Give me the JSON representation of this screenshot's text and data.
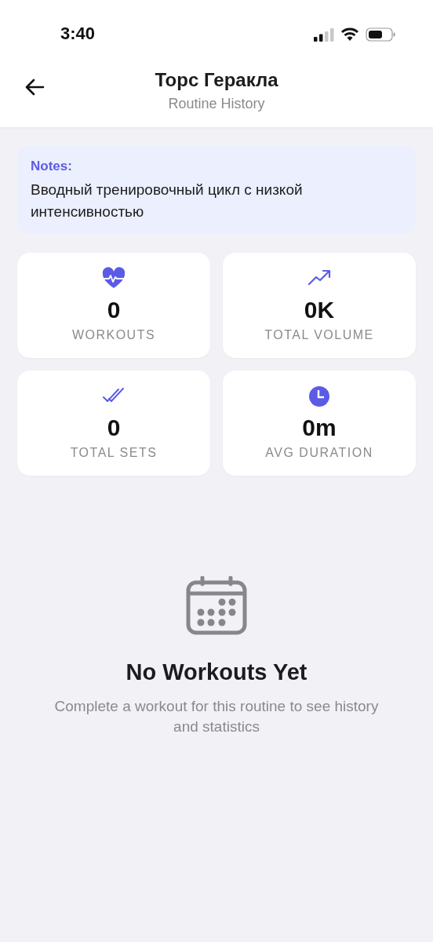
{
  "status_bar": {
    "time": "3:40"
  },
  "header": {
    "title": "Торс Геракла",
    "subtitle": "Routine History"
  },
  "notes": {
    "label": "Notes:",
    "text": "Вводный тренировочный цикл с низкой интенсивностью"
  },
  "stats": [
    {
      "kind": "heart",
      "value": "0",
      "label": "WORKOUTS"
    },
    {
      "kind": "trend",
      "value": "0K",
      "label": "TOTAL VOLUME"
    },
    {
      "kind": "checks",
      "value": "0",
      "label": "TOTAL SETS"
    },
    {
      "kind": "clock",
      "value": "0m",
      "label": "AVG DURATION"
    }
  ],
  "empty_state": {
    "title": "No Workouts Yet",
    "text": "Complete a workout for this routine to see history and statistics"
  }
}
